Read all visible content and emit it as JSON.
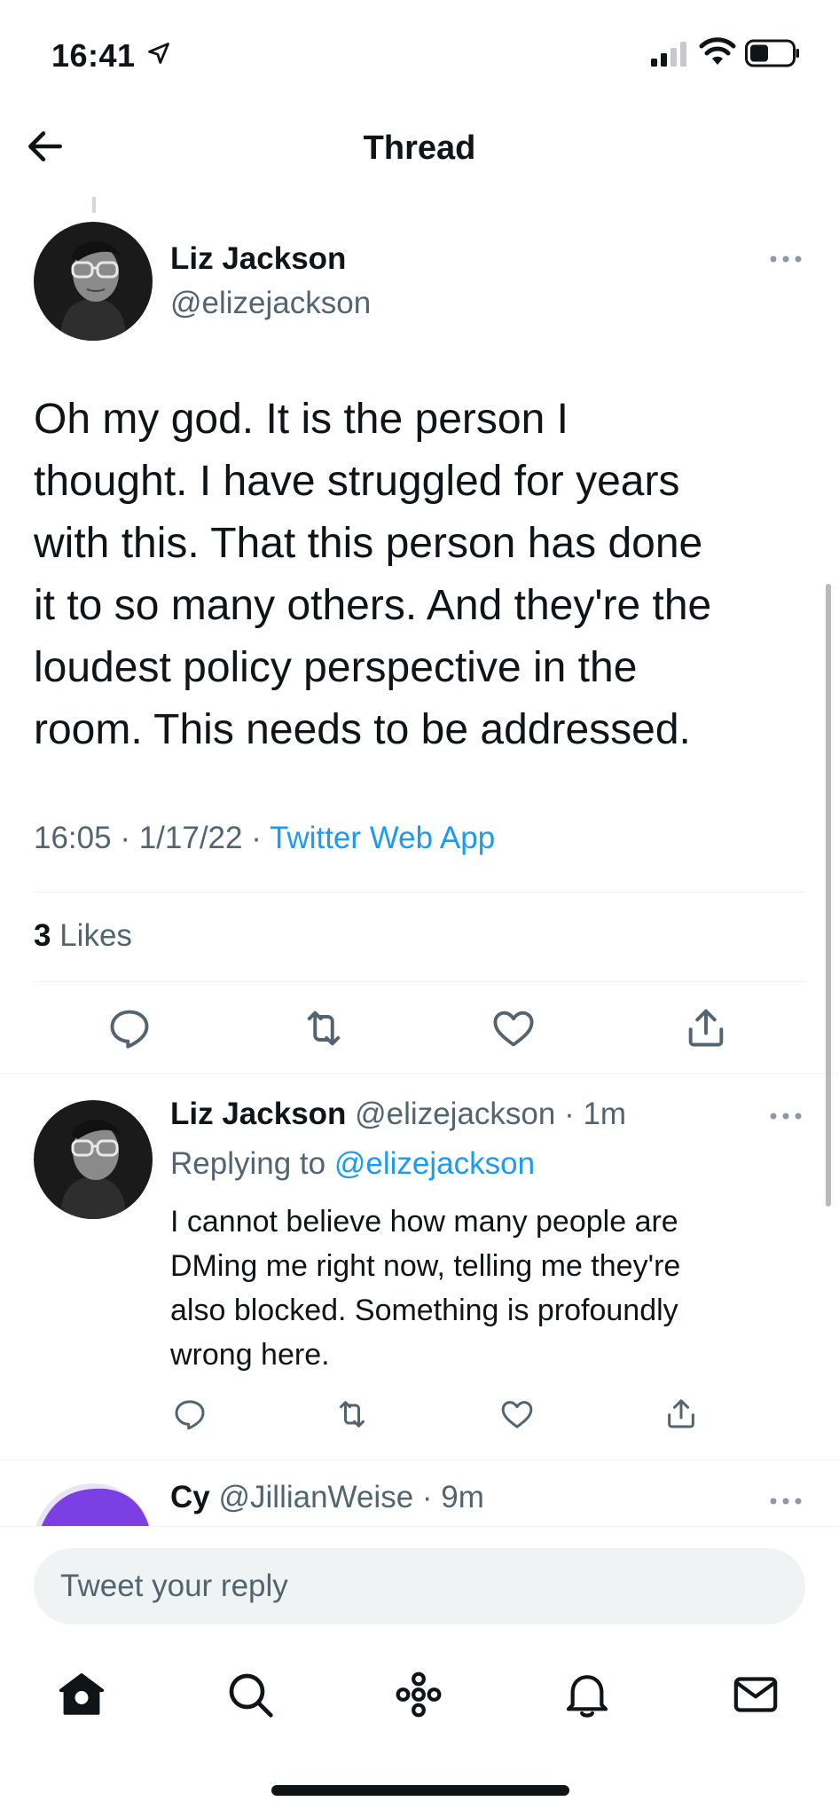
{
  "status_bar": {
    "time": "16:41"
  },
  "nav": {
    "title": "Thread"
  },
  "main_tweet": {
    "author_name": "Liz Jackson",
    "author_handle": "@elizejackson",
    "text_lines": [
      "Oh my god. It is the person I",
      "thought. I have struggled for years",
      "with this. That this person has done",
      "it to so many others. And they're the",
      "loudest policy perspective in the",
      "room. This needs to be addressed."
    ],
    "time": "16:05",
    "date": "1/17/22",
    "source": "Twitter Web App",
    "likes_count": "3",
    "likes_label": "Likes"
  },
  "reply_tweet": {
    "author_name": "Liz Jackson",
    "author_handle": "@elizejackson",
    "age": "1m",
    "replying_label": "Replying to",
    "replying_to": "@elizejackson",
    "text_lines": [
      "I cannot believe how many people are",
      "DMing me right now, telling me they're",
      "also blocked. Something is profoundly",
      "wrong here."
    ]
  },
  "next_tweet": {
    "author_name": "Cy",
    "author_handle": "@JillianWeise",
    "age": "9m"
  },
  "compose": {
    "placeholder": "Tweet your reply"
  },
  "tab_bar": {
    "items": [
      "home-icon",
      "search-icon",
      "spaces-icon",
      "notifications-icon",
      "messages-icon"
    ]
  },
  "colors": {
    "accent": "#1d9bf0",
    "text_primary": "#0f1419",
    "text_secondary": "#536471",
    "divider": "#eff3f4"
  }
}
